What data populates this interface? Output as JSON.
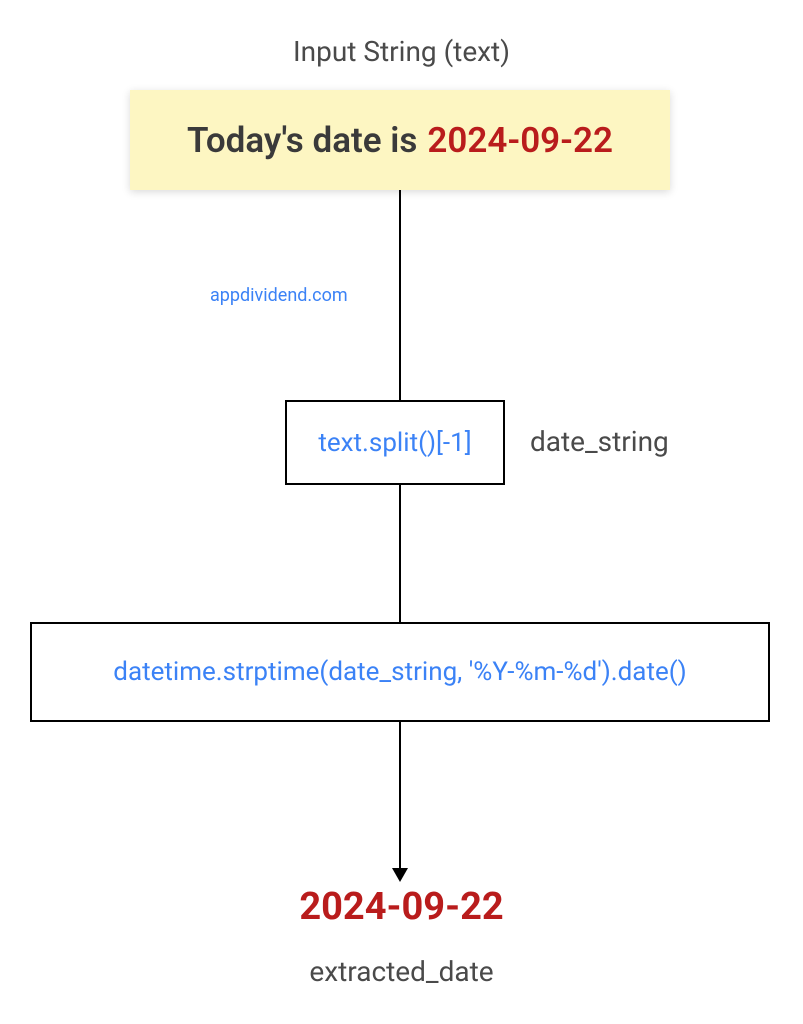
{
  "title": "Input String (text)",
  "input_box": {
    "prefix": "Today's date is",
    "date": "2024-09-22"
  },
  "watermark": "appdividend.com",
  "split": {
    "code": "text.split()[-1]",
    "label": "date_string"
  },
  "strptime": {
    "code": "datetime.strptime(date_string, '%Y-%m-%d').date()"
  },
  "result": {
    "date": "2024-09-22",
    "label": "extracted_date"
  }
}
